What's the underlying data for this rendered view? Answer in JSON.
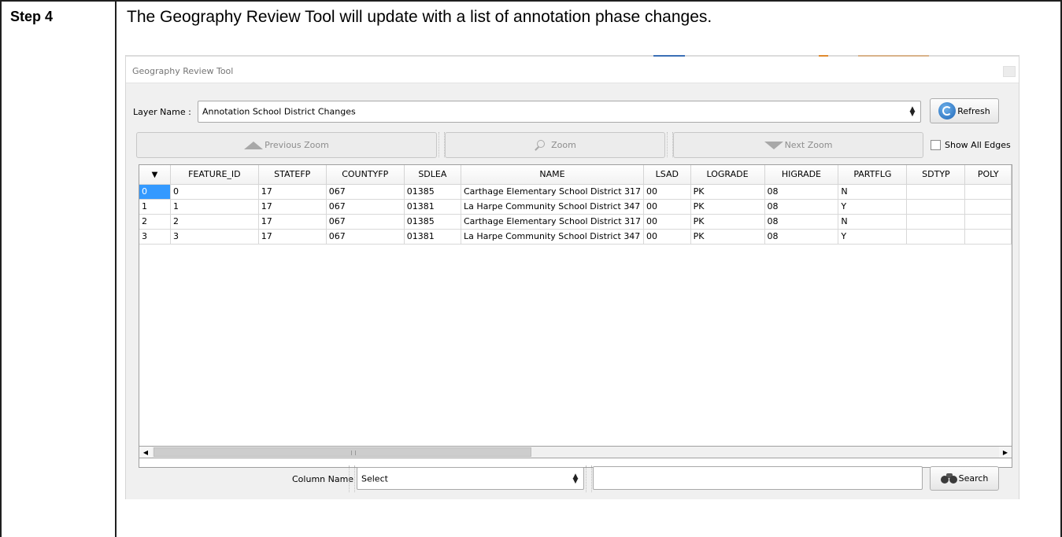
{
  "document": {
    "step_label": "Step 4",
    "step_description": "The Geography Review Tool will update with a list of annotation phase changes."
  },
  "window": {
    "title": "Geography Review Tool"
  },
  "layer": {
    "label": "Layer Name :",
    "value": "Annotation School District Changes",
    "refresh_label": "Refresh"
  },
  "toolbar": {
    "previous_zoom_label": "Previous Zoom",
    "zoom_label": "Zoom",
    "next_zoom_label": "Next Zoom",
    "show_all_edges_label": "Show All Edges",
    "show_all_edges_checked": false
  },
  "table": {
    "columns": [
      "FEATURE_ID",
      "STATEFP",
      "COUNTYFP",
      "SDLEA",
      "NAME",
      "LSAD",
      "LOGRADE",
      "HIGRADE",
      "PARTFLG",
      "SDTYP",
      "POLY"
    ],
    "rows": [
      {
        "index": "0",
        "cells": [
          "0",
          "17",
          "067",
          "01385",
          "Carthage Elementary School District 317",
          "00",
          "PK",
          "08",
          "N",
          "",
          ""
        ]
      },
      {
        "index": "1",
        "cells": [
          "1",
          "17",
          "067",
          "01381",
          "La Harpe Community School District 347",
          "00",
          "PK",
          "08",
          "Y",
          "",
          ""
        ]
      },
      {
        "index": "2",
        "cells": [
          "2",
          "17",
          "067",
          "01385",
          "Carthage Elementary School District 317",
          "00",
          "PK",
          "08",
          "N",
          "",
          ""
        ]
      },
      {
        "index": "3",
        "cells": [
          "3",
          "17",
          "067",
          "01381",
          "La Harpe Community School District 347",
          "00",
          "PK",
          "08",
          "Y",
          "",
          ""
        ]
      }
    ],
    "selected_index": "0"
  },
  "search": {
    "column_label": "Column Name :",
    "column_value": "Select",
    "query_value": "",
    "search_label": "Search"
  },
  "colors": {
    "selection": "#3399ff",
    "accent_blue": "#1d66b8"
  }
}
